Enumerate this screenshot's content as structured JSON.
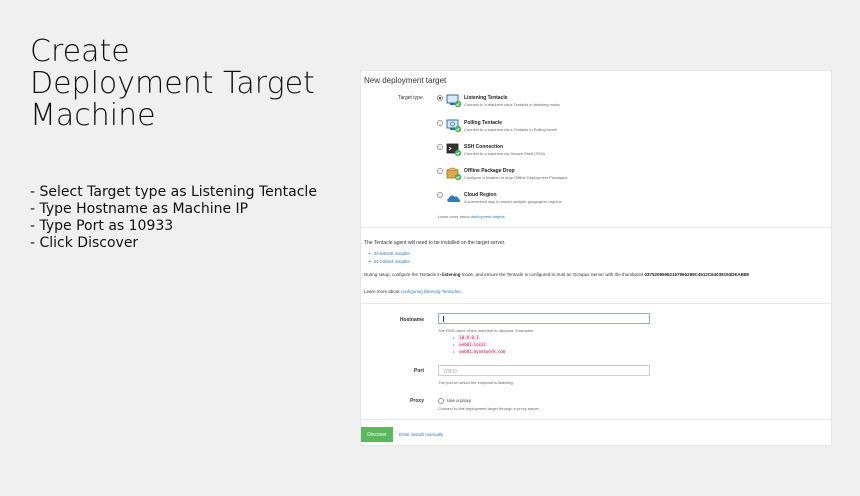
{
  "slide": {
    "title_lines": [
      "Create",
      "Deployment Target",
      "Machine"
    ],
    "instructions": [
      "- Select Target type as Listening Tentacle",
      "- Type Hostname as Machine IP",
      "- Type Port as 10933",
      "- Click Discover"
    ]
  },
  "app": {
    "panel_title": "New deployment target",
    "target_type_label": "Target type",
    "options": [
      {
        "name": "Listening Tentacle",
        "desc": "Connect to a machine via a Tentacle in listening mode",
        "icon": "monitor-check-icon",
        "selected": true
      },
      {
        "name": "Polling Tentacle",
        "desc": "Connect to a machine via a Tentacle in Polling mode",
        "icon": "monitor-poll-icon",
        "selected": false
      },
      {
        "name": "SSH Connection",
        "desc": "Connect to a machine via Secure Shell (SSH)",
        "icon": "terminal-icon",
        "selected": false
      },
      {
        "name": "Offline Package Drop",
        "desc": "Configure a location to drop Offline Deployment Packages",
        "icon": "box-icon",
        "selected": false
      },
      {
        "name": "Cloud Region",
        "desc": "A convenient way to model multiple geographic regions",
        "icon": "cloud-icon",
        "selected": false
      }
    ],
    "learn_more_prefix": "Learn more about ",
    "learn_more_link": "deployment targets",
    "learn_more_suffix": ".",
    "agent_text": "The Tentacle agent will need to be installed on the target server.",
    "installers": [
      "32-bit/x86 installer",
      "64-bit/x64 installer"
    ],
    "during_prefix": "During setup, configure the Tentacle in ",
    "during_mode": "listening",
    "during_mid": " mode, and ensure the Tentacle is configured to trust an Octopus Server with the thumbprint ",
    "thumbprint": "03752085962157966289C4512C64038194DEAB88",
    "learn2_prefix": "Learn more about ",
    "learn2_link": "configuring listening Tentacles",
    "learn2_suffix": ".",
    "hostname_label": "Hostname",
    "hostname_value": "",
    "hostname_help": "The DNS name of the machine to discover. Examples:",
    "examples": [
      "10.0.0.1",
      "web01.local",
      "web01.mynetwork.com"
    ],
    "port_label": "Port",
    "port_placeholder": "10933",
    "port_help": "The port on which the endpoint is listening.",
    "proxy_label": "Proxy",
    "proxy_option": "Use a proxy",
    "proxy_help": "Connect to this deployment target through a proxy server.",
    "discover_label": "Discover",
    "manual_link": "Enter details manually",
    "colors": {
      "accent": "#2f7bbd",
      "success": "#5cb85c",
      "check": "#48b35a"
    }
  }
}
